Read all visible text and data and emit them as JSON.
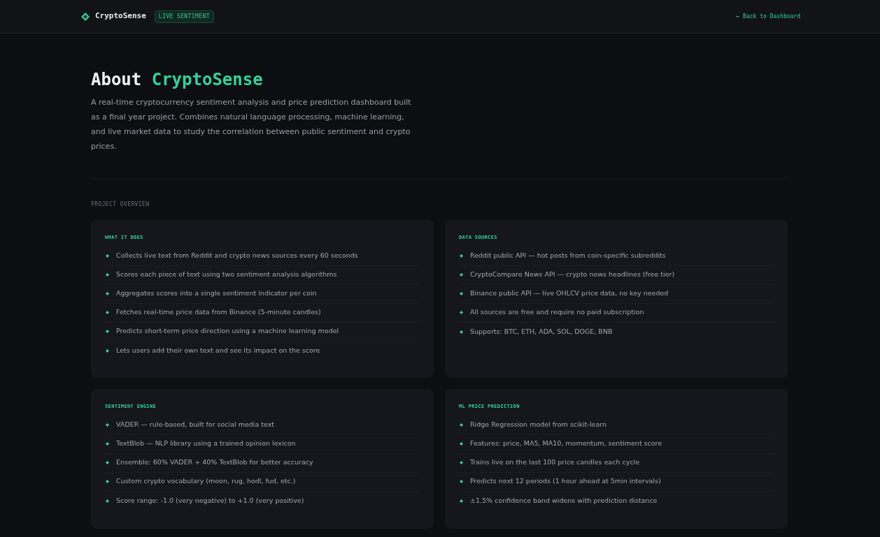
{
  "nav": {
    "logo": "CryptoSense",
    "badge": "LIVE SENTIMENT",
    "back_link": "← Back to Dashboard"
  },
  "hero": {
    "title_plain": "About",
    "title_accent": "CryptoSense",
    "description": "A real-time cryptocurrency sentiment analysis and price prediction dashboard built as a final year project. Combines natural language processing, machine learning, and live market data to study the correlation between public sentiment and crypto prices."
  },
  "section_label": "PROJECT OVERVIEW",
  "cards": [
    {
      "title": "WHAT IT DOES",
      "items": [
        "Collects live text from Reddit and crypto news sources every 60 seconds",
        "Scores each piece of text using two sentiment analysis algorithms",
        "Aggregates scores into a single sentiment indicator per coin",
        "Fetches real-time price data from Binance (5-minute candles)",
        "Predicts short-term price direction using a machine learning model",
        "Lets users add their own text and see its impact on the score"
      ]
    },
    {
      "title": "DATA SOURCES",
      "items": [
        "Reddit public API — hot posts from coin-specific subreddits",
        "CryptoCompare News API — crypto news headlines (free tier)",
        "Binance public API — live OHLCV price data, no key needed",
        "All sources are free and require no paid subscription",
        "Supports: BTC, ETH, ADA, SOL, DOGE, BNB"
      ]
    },
    {
      "title": "SENTIMENT ENGINE",
      "items": [
        "VADER — rule-based, built for social media text",
        "TextBlob — NLP library using a trained opinion lexicon",
        "Ensemble: 60% VADER + 40% TextBlob for better accuracy",
        "Custom crypto vocabulary (moon, rug, hodl, fud, etc.)",
        "Score range: -1.0 (very negative) to +1.0 (very positive)"
      ]
    },
    {
      "title": "ML PRICE PREDICTION",
      "items": [
        "Ridge Regression model from scikit-learn",
        "Features: price, MA5, MA10, momentum, sentiment score",
        "Trains live on the last 100 price candles each cycle",
        "Predicts next 12 periods (1 hour ahead at 5min intervals)",
        "±1.5% confidence band widens with prediction distance"
      ]
    }
  ]
}
